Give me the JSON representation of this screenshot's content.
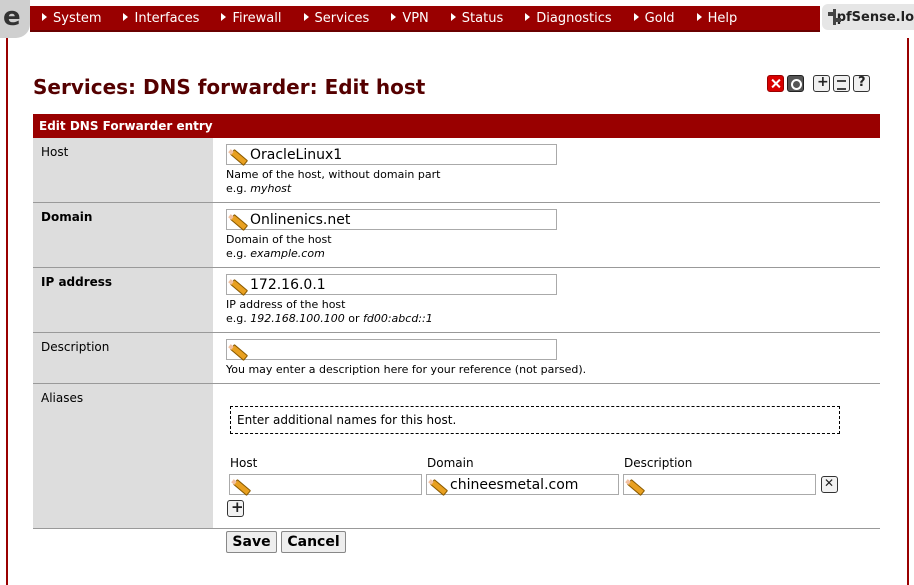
{
  "logo_glyph": "e",
  "nav": {
    "items": [
      "System",
      "Interfaces",
      "Firewall",
      "Services",
      "VPN",
      "Status",
      "Diagnostics",
      "Gold",
      "Help"
    ],
    "brand": "pfSense.lo"
  },
  "page": {
    "title": "Services: DNS forwarder: Edit host",
    "icons": [
      "close-icon",
      "refresh-icon",
      "add-icon",
      "list-icon",
      "help-icon"
    ]
  },
  "form": {
    "header": "Edit DNS Forwarder entry",
    "host": {
      "label": "Host",
      "value": "OracleLinux1",
      "hint": "Name of the host, without domain part",
      "example_prefix": "e.g. ",
      "example": "myhost"
    },
    "domain": {
      "label": "Domain",
      "value": "Onlinenics.net",
      "hint": "Domain of the host",
      "example_prefix": "e.g. ",
      "example": "example.com"
    },
    "ip": {
      "label": "IP address",
      "value": "172.16.0.1",
      "hint": "IP address of the host",
      "example_prefix": "e.g. ",
      "example1": "192.168.100.100",
      "or": " or ",
      "example2": "fd00:abcd::1"
    },
    "description": {
      "label": "Description",
      "value": "",
      "hint": "You may enter a description here for your reference (not parsed)."
    },
    "aliases": {
      "label": "Aliases",
      "info": "Enter additional names for this host.",
      "col_host": "Host",
      "col_domain": "Domain",
      "col_description": "Description",
      "row": {
        "host": "",
        "domain": "chineesmetal.com",
        "description": ""
      }
    }
  },
  "buttons": {
    "save": "Save",
    "cancel": "Cancel"
  },
  "colors": {
    "nav_bg": "#990000",
    "title": "#550000",
    "label_bg": "#dddddd"
  }
}
